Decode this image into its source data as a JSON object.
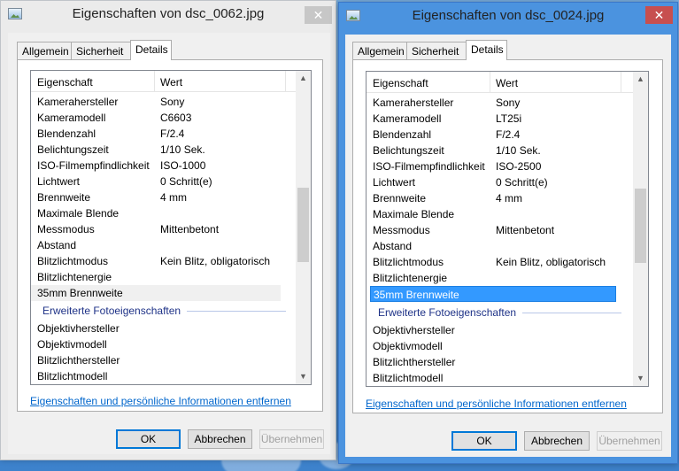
{
  "windows": [
    {
      "title": "Eigenschaften von dsc_0062.jpg",
      "close_symbol": "✕",
      "tabs": [
        "Allgemein",
        "Sicherheit",
        "Details"
      ],
      "selected_tab": "Details",
      "columns": {
        "property": "Eigenschaft",
        "value": "Wert"
      },
      "rows": [
        {
          "property": "Kamerahersteller",
          "value": "Sony"
        },
        {
          "property": "Kameramodell",
          "value": "C6603"
        },
        {
          "property": "Blendenzahl",
          "value": "F/2.4"
        },
        {
          "property": "Belichtungszeit",
          "value": "1/10 Sek."
        },
        {
          "property": "ISO-Filmempfindlichkeit",
          "value": "ISO-1000"
        },
        {
          "property": "Lichtwert",
          "value": "0 Schritt(e)"
        },
        {
          "property": "Brennweite",
          "value": "4 mm"
        },
        {
          "property": "Maximale Blende",
          "value": ""
        },
        {
          "property": "Messmodus",
          "value": "Mittenbetont"
        },
        {
          "property": "Abstand",
          "value": ""
        },
        {
          "property": "Blitzlichtmodus",
          "value": "Kein Blitz, obligatorisch"
        },
        {
          "property": "Blitzlichtenergie",
          "value": ""
        },
        {
          "property": "35mm Brennweite",
          "value": ""
        }
      ],
      "group_label": "Erweiterte Fotoeigenschaften",
      "group_rows": [
        {
          "property": "Objektivhersteller",
          "value": ""
        },
        {
          "property": "Objektivmodell",
          "value": ""
        },
        {
          "property": "Blitzlichthersteller",
          "value": ""
        },
        {
          "property": "Blitzlichtmodell",
          "value": ""
        }
      ],
      "link": "Eigenschaften und persönliche Informationen entfernen",
      "buttons": {
        "ok": "OK",
        "cancel": "Abbrechen",
        "apply": "Übernehmen"
      }
    },
    {
      "title": "Eigenschaften von dsc_0024.jpg",
      "close_symbol": "✕",
      "tabs": [
        "Allgemein",
        "Sicherheit",
        "Details"
      ],
      "selected_tab": "Details",
      "columns": {
        "property": "Eigenschaft",
        "value": "Wert"
      },
      "rows": [
        {
          "property": "Kamerahersteller",
          "value": "Sony"
        },
        {
          "property": "Kameramodell",
          "value": "LT25i"
        },
        {
          "property": "Blendenzahl",
          "value": "F/2.4"
        },
        {
          "property": "Belichtungszeit",
          "value": "1/10 Sek."
        },
        {
          "property": "ISO-Filmempfindlichkeit",
          "value": "ISO-2500"
        },
        {
          "property": "Lichtwert",
          "value": "0 Schritt(e)"
        },
        {
          "property": "Brennweite",
          "value": "4 mm"
        },
        {
          "property": "Maximale Blende",
          "value": ""
        },
        {
          "property": "Messmodus",
          "value": "Mittenbetont"
        },
        {
          "property": "Abstand",
          "value": ""
        },
        {
          "property": "Blitzlichtmodus",
          "value": "Kein Blitz, obligatorisch"
        },
        {
          "property": "Blitzlichtenergie",
          "value": ""
        },
        {
          "property": "35mm Brennweite",
          "value": ""
        }
      ],
      "group_label": "Erweiterte Fotoeigenschaften",
      "group_rows": [
        {
          "property": "Objektivhersteller",
          "value": ""
        },
        {
          "property": "Objektivmodell",
          "value": ""
        },
        {
          "property": "Blitzlichthersteller",
          "value": ""
        },
        {
          "property": "Blitzlichtmodell",
          "value": ""
        }
      ],
      "link": "Eigenschaften und persönliche Informationen entfernen",
      "buttons": {
        "ok": "OK",
        "cancel": "Abbrechen",
        "apply": "Übernehmen"
      }
    }
  ],
  "colors": {
    "inactive_frame": "#ebebeb",
    "active_frame": "#4b93df",
    "selection": "#3399ff",
    "link": "#0066cc",
    "group_heading": "#1e3287"
  }
}
